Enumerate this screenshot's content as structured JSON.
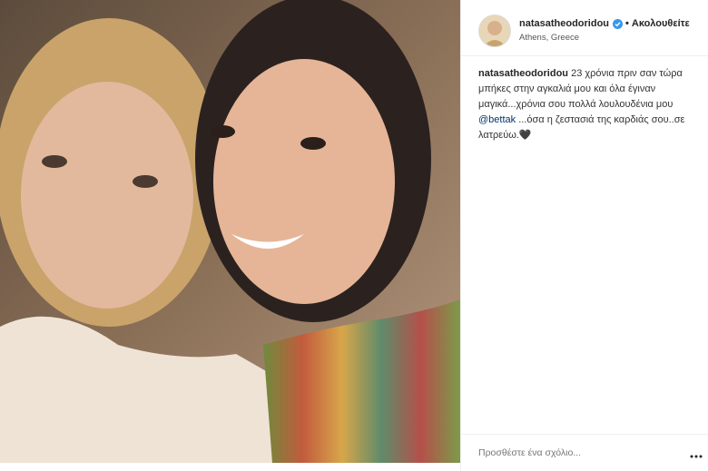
{
  "post": {
    "username": "natasatheodoridou",
    "separator": "•",
    "follow_label": "Ακολουθείτε",
    "location": "Athens, Greece"
  },
  "caption": {
    "username": "natasatheodoridou",
    "text_before_mention": " 23 χρόνια πριν σαν τώρα μπήκες στην αγκαλιά μου και όλα έγιναν μαγικά...χρόνια σου πολλά λουλουδένια μου ",
    "mention": "@bettak",
    "text_after_mention": " ...όσα η ζεστασιά της καρδιάς σου..σε λατρεύω.",
    "emoji": "🖤"
  },
  "comment": {
    "placeholder": "Προσθέστε ένα σχόλιο..."
  },
  "icons": {
    "verified": "verified-badge-icon",
    "more": "more-options-icon"
  },
  "colors": {
    "verified_blue": "#3897f0",
    "mention": "#003569",
    "border": "#efefef",
    "placeholder": "#8e8e8e"
  }
}
